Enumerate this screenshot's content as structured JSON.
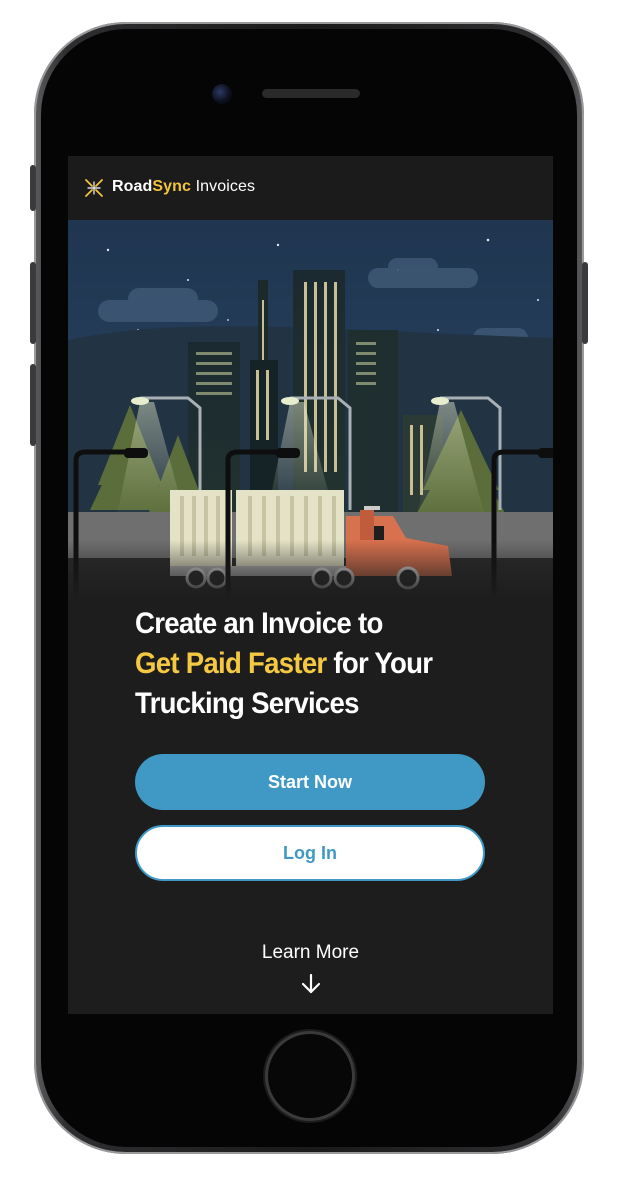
{
  "app": {
    "brand_part1": "Road",
    "brand_part2": "Sync",
    "brand_part3": " Invoices"
  },
  "hero": {
    "headline_line1": "Create an Invoice to",
    "headline_highlight": "Get Paid Faster",
    "headline_line2_rest": " for Your",
    "headline_line3": "Trucking Services"
  },
  "actions": {
    "start_label": "Start Now",
    "login_label": "Log In",
    "learn_more_label": "Learn More"
  },
  "colors": {
    "accent_yellow": "#f3c33c",
    "primary_blue": "#3f99c4",
    "background": "#1d1d1d"
  },
  "icons": {
    "logo": "roadsync-logo-icon",
    "learn_more": "arrow-down-icon"
  }
}
